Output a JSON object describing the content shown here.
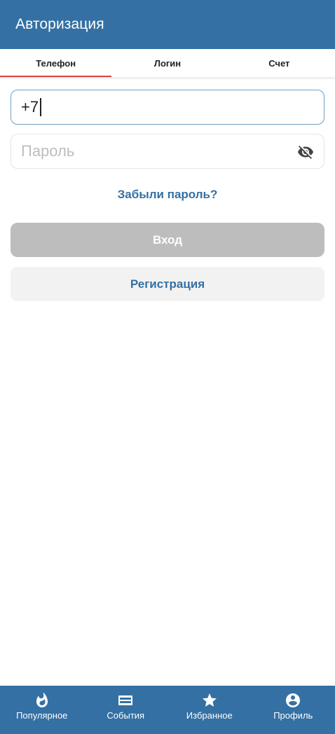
{
  "header": {
    "title": "Авторизация"
  },
  "tabs": [
    {
      "label": "Телефон",
      "active": true
    },
    {
      "label": "Логин",
      "active": false
    },
    {
      "label": "Счет",
      "active": false
    }
  ],
  "form": {
    "phone_value": "+7",
    "password_placeholder": "Пароль",
    "forgot_label": "Забыли пароль?",
    "login_label": "Вход",
    "register_label": "Регистрация"
  },
  "bottom_nav": [
    {
      "label": "Популярное",
      "icon": "fire-icon"
    },
    {
      "label": "События",
      "icon": "ticket-icon"
    },
    {
      "label": "Избранное",
      "icon": "star-icon"
    },
    {
      "label": "Профиль",
      "icon": "account-icon"
    }
  ],
  "colors": {
    "primary": "#3470a4",
    "tab_indicator": "#d64545",
    "disabled_button": "#bdbdbd",
    "secondary_button": "#f2f2f2"
  }
}
